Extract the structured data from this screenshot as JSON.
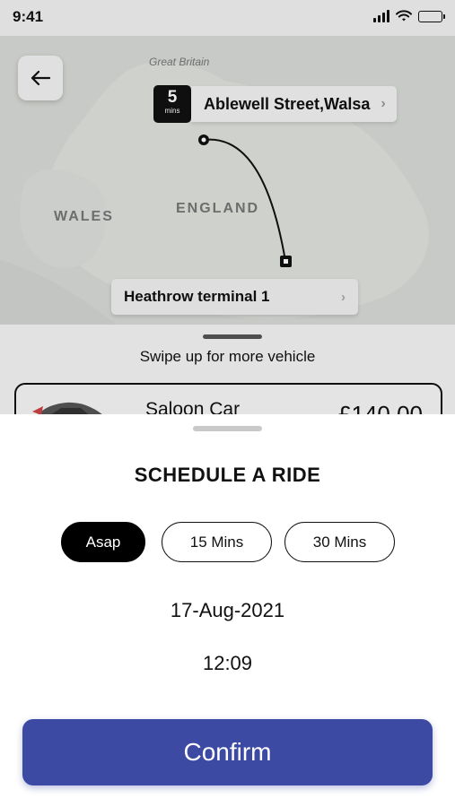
{
  "status_bar": {
    "time": "9:41"
  },
  "map": {
    "region_label": "Great Britain",
    "labels": [
      "WALES",
      "ENGLAND"
    ]
  },
  "route": {
    "eta_value": "5",
    "eta_unit": "mins",
    "pickup": "Ablewell Street,Walsa",
    "destination": "Heathrow terminal 1"
  },
  "vehicle_panel": {
    "swipe_hint": "Swipe up for more vehicle",
    "vehicle_name": "Saloon Car",
    "vehicle_price": "£140.00"
  },
  "schedule": {
    "title": "SCHEDULE A RIDE",
    "options": [
      {
        "label": "Asap",
        "selected": true
      },
      {
        "label": "15 Mins",
        "selected": false
      },
      {
        "label": "30 Mins",
        "selected": false
      }
    ],
    "date": "17-Aug-2021",
    "time": "12:09",
    "confirm_label": "Confirm"
  },
  "colors": {
    "primary": "#3c4aa3",
    "selected_option": "#000000"
  }
}
